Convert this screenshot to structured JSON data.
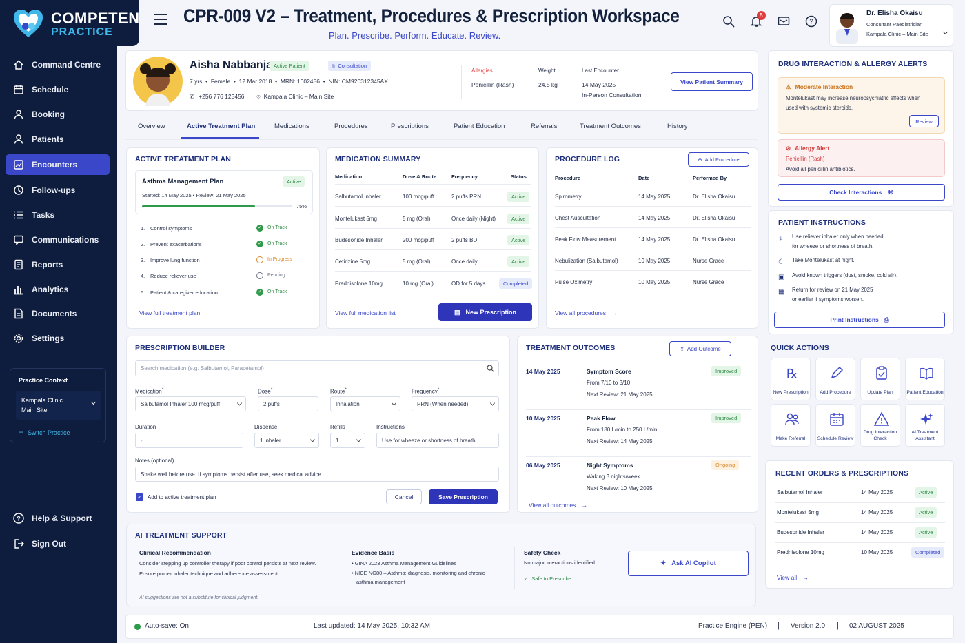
{
  "app": {
    "brand_top": "COMPETEN",
    "brand_bottom": "PRACTICE",
    "title": "CPR-009 V2 – Treatment, Procedures & Prescription Workspace",
    "subtitle": "Plan. Prescribe. Perform. Educate. Review.",
    "notification_count": "5",
    "accent": "#3a47c9",
    "sidebar_bg": "#0e1c3d"
  },
  "user": {
    "name": "Dr. Elisha Okaisu",
    "role": "Consultant Paediatrician",
    "site": "Kampala Clinic – Main Site"
  },
  "nav": [
    {
      "label": "Command Centre",
      "icon": "home-icon"
    },
    {
      "label": "Schedule",
      "icon": "calendar-icon"
    },
    {
      "label": "Booking",
      "icon": "person-icon"
    },
    {
      "label": "Patients",
      "icon": "person-icon"
    },
    {
      "label": "Encounters",
      "icon": "chart-icon"
    },
    {
      "label": "Follow-ups",
      "icon": "follow-icon"
    },
    {
      "label": "Tasks",
      "icon": "list-icon"
    },
    {
      "label": "Communications",
      "icon": "chat-icon"
    },
    {
      "label": "Reports",
      "icon": "report-icon"
    },
    {
      "label": "Analytics",
      "icon": "bar-icon"
    },
    {
      "label": "Documents",
      "icon": "doc-icon"
    },
    {
      "label": "Settings",
      "icon": "gear-icon"
    }
  ],
  "practice_context": {
    "title": "Practice Context",
    "clinic_line1": "Kampala Clinic",
    "clinic_line2": "Main Site",
    "switch": "Switch Practice"
  },
  "footer_nav": {
    "help": "Help & Support",
    "signout": "Sign Out"
  },
  "patient": {
    "name": "Aisha Nabbanja",
    "badge_status": "Active Patient",
    "badge_visit": "In Consultation",
    "age": "7 yrs",
    "sex": "Female",
    "dob": "12 Mar 2018",
    "mrn": "MRN:  1002456",
    "nin": "NIN:  CM920312345AX",
    "phone": "+256 776 123456",
    "location": "Kampala Clinic – Main Site",
    "allergies_label": "Allergies",
    "allergies": "Penicillin (Rash)",
    "weight_label": "Weight",
    "weight": "24.5 kg",
    "last_label": "Last Encounter",
    "last_date": "14 May 2025",
    "last_type": "In-Person Consultation",
    "summary_btn": "View Patient Summary"
  },
  "tabs": [
    "Overview",
    "Active Treatment Plan",
    "Medications",
    "Procedures",
    "Prescriptions",
    "Patient Education",
    "Referrals",
    "Treatment Outcomes",
    "History"
  ],
  "treatment_plan": {
    "title": "ACTIVE TREATMENT PLAN",
    "plan_name": "Asthma Management Plan",
    "status": "Active",
    "started": "Started: 14 May 2025  •  Review: 21 May 2025",
    "progress": 0.75,
    "progress_label": "75%",
    "goals": [
      {
        "n": "1.",
        "text": "Control symptoms",
        "status": "On Track"
      },
      {
        "n": "2.",
        "text": "Prevent exacerbations",
        "status": "On Track"
      },
      {
        "n": "3.",
        "text": "Improve lung function",
        "status": "In Progress"
      },
      {
        "n": "4.",
        "text": "Reduce reliever use",
        "status": "Pending"
      },
      {
        "n": "5.",
        "text": "Patient & caregiver education",
        "status": "On Track"
      }
    ],
    "link": "View full treatment plan"
  },
  "medications": {
    "title": "MEDICATION SUMMARY",
    "headers": [
      "Medication",
      "Dose & Route",
      "Frequency",
      "Status"
    ],
    "rows": [
      [
        "Salbutamol Inhaler",
        "100 mcg/puff",
        "2 puffs PRN",
        "Active"
      ],
      [
        "Montelukast 5mg",
        "5 mg (Oral)",
        "Once daily (Night)",
        "Active"
      ],
      [
        "Budesonide Inhaler",
        "200 mcg/puff",
        "2 puffs BD",
        "Active"
      ],
      [
        "Cetirizine 5mg",
        "5 mg (Oral)",
        "Once daily",
        "Active"
      ],
      [
        "Prednisolone 10mg",
        "10 mg (Oral)",
        "OD for 5 days",
        "Completed"
      ]
    ],
    "link": "View full medication list",
    "new_btn": "New Prescription"
  },
  "procedures": {
    "title": "PROCEDURE LOG",
    "add_btn": "Add Procedure",
    "headers": [
      "Procedure",
      "Date",
      "Performed By"
    ],
    "rows": [
      [
        "Spirometry",
        "14 May 2025",
        "Dr. Elisha Okaisu"
      ],
      [
        "Chest Auscultation",
        "14 May 2025",
        "Dr. Elisha Okaisu"
      ],
      [
        "Peak Flow Measurement",
        "14 May 2025",
        "Dr. Elisha Okaisu"
      ],
      [
        "Nebulization (Salbutamol)",
        "10 May 2025",
        "Nurse Grace"
      ],
      [
        "Pulse Oximetry",
        "10 May 2025",
        "Nurse Grace"
      ]
    ],
    "link": "View all procedures"
  },
  "alerts": {
    "title": "DRUG INTERACTION & ALLERGY ALERTS",
    "moderate_title": "Moderate Interaction",
    "moderate_text": "Montelukast may increase neuropsychiatric effects when used with systemic steroids.",
    "review": "Review",
    "allergy_title": "Allergy Alert",
    "allergy_drug": "Penicillin (Rash)",
    "allergy_text": "Avoid all penicillin antibiotics.",
    "check_btn": "Check Interactions"
  },
  "instructions": {
    "title": "PATIENT INSTRUCTIONS",
    "items": [
      [
        "Use reliever inhaler only when needed",
        "for wheeze or shortness of breath."
      ],
      [
        "Take Montelukast at night.",
        ""
      ],
      [
        "Avoid known triggers (dust, smoke, cold air).",
        ""
      ],
      [
        "Return for review on 21 May 2025",
        "or earlier if symptoms worsen."
      ]
    ],
    "print_btn": "Print Instructions"
  },
  "builder": {
    "title": "PRESCRIPTION BUILDER",
    "search_placeholder": "Search medication (e.g. Salbutamol, Paracetamol)",
    "medication_label": "Medication",
    "medication": "Salbutamol Inhaler 100 mcg/puff",
    "dose_label": "Dose",
    "dose": "2 puffs",
    "route_label": "Route",
    "route": "Inhalation",
    "freq_label": "Frequency",
    "freq": "PRN (When needed)",
    "duration_label": "Duration",
    "duration": "-",
    "dispense_label": "Dispense",
    "dispense": "1 inhaler",
    "refills_label": "Refills",
    "refills": "1",
    "instr_label": "Instructions",
    "instr": "Use for wheeze or shortness of breath",
    "notes_label": "Notes (optional)",
    "notes": "Shake well before use. If symptoms persist after use, seek medical advice.",
    "checkbox": "Add to active treatment plan",
    "cancel": "Cancel",
    "save": "Save Prescription"
  },
  "outcomes": {
    "title": "TREATMENT OUTCOMES",
    "add_btn": "Add Outcome",
    "items": [
      {
        "date": "14 May 2025",
        "name": "Symptom Score",
        "detail": "From 7/10 to 3/10",
        "next": "Next Review:  21 May 2025",
        "status": "Improved"
      },
      {
        "date": "10 May 2025",
        "name": "Peak Flow",
        "detail": "From 180 L/min to 250 L/min",
        "next": "Next Review:  14 May 2025",
        "status": "Improved"
      },
      {
        "date": "06 May 2025",
        "name": "Night Symptoms",
        "detail": "Waking 3 nights/week",
        "next": "Next Review:  10 May 2025",
        "status": "Ongoing"
      }
    ],
    "link": "View all outcomes"
  },
  "quick_actions": {
    "title": "QUICK ACTIONS",
    "items": [
      [
        "New Prescription",
        ""
      ],
      [
        "Add Procedure",
        ""
      ],
      [
        "Update Plan",
        ""
      ],
      [
        "Patient Education",
        ""
      ],
      [
        "Make Referral",
        ""
      ],
      [
        "Schedule Review",
        ""
      ],
      [
        "Drug Interaction",
        "Check"
      ],
      [
        "AI Treatment",
        "Assistant"
      ]
    ]
  },
  "recent": {
    "title": "RECENT ORDERS & PRESCRIPTIONS",
    "rows": [
      [
        "Salbutamol Inhaler",
        "14 May 2025",
        "Active"
      ],
      [
        "Montelukast 5mg",
        "14 May 2025",
        "Active"
      ],
      [
        "Budesonide Inhaler",
        "14 May 2025",
        "Active"
      ],
      [
        "Prednisolone 10mg",
        "10 May 2025",
        "Completed"
      ]
    ],
    "link": "View all"
  },
  "ai": {
    "title": "AI TREATMENT SUPPORT",
    "rec_title": "Clinical Recommendation",
    "rec_1": "Consider stepping up controller therapy if poor control persists at next review.",
    "rec_2": "Ensure proper inhaler technique and adherence assessment.",
    "ev_title": "Evidence Basis",
    "ev_1": "•  GINA 2023 Asthma Management Guidelines",
    "ev_2": "•  NICE NG80 – Asthma: diagnosis, monitoring and chronic",
    "ev_3": "asthma management",
    "safe_title": "Safety Check",
    "safe_1": "No major interactions identified.",
    "safe_2": "Safe to Prescribe",
    "ask": "Ask AI Copilot",
    "disclaimer": "AI suggestions are not a substitute for clinical judgment."
  },
  "status_bar": {
    "autosave": "Auto-save: On",
    "updated": "Last updated:  14 May 2025, 10:32 AM",
    "engine": "Practice Engine (PEN)",
    "version": "Version 2.0",
    "date": "02 AUGUST 2025"
  }
}
